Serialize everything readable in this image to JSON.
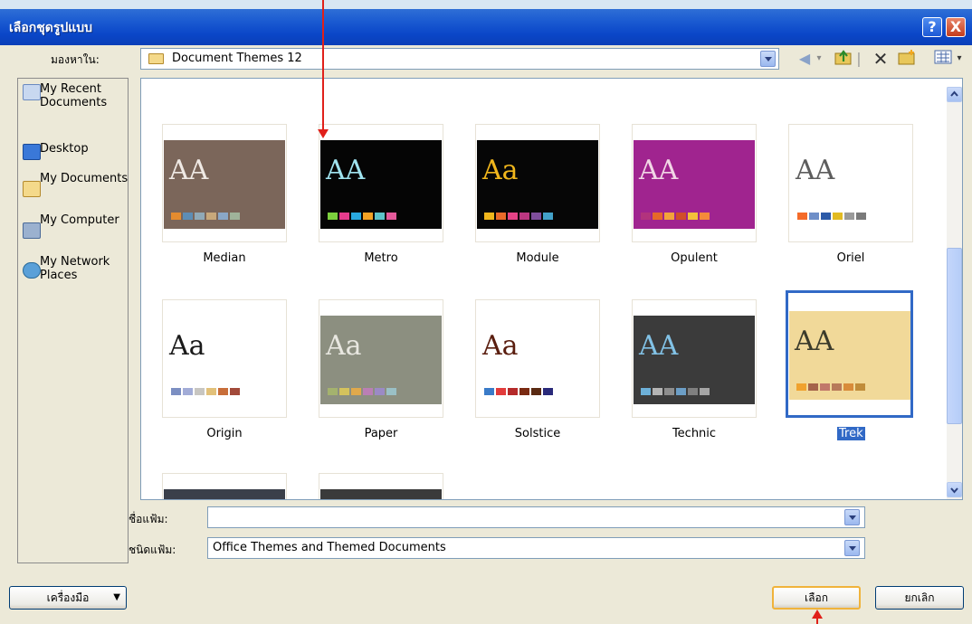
{
  "window": {
    "title": "เลือกชุดรูปแบบ",
    "help_label": "?",
    "close_label": "X"
  },
  "look_in": {
    "label": "มองหาใน:",
    "value": "Document Themes 12"
  },
  "toolbar_icons": [
    "back-icon",
    "up-folder-icon",
    "delete-icon",
    "new-folder-icon",
    "views-icon"
  ],
  "places": [
    {
      "label": "My Recent Documents",
      "icon": "recent-documents-icon"
    },
    {
      "label": "Desktop",
      "icon": "desktop-icon"
    },
    {
      "label": "My Documents",
      "icon": "my-documents-icon"
    },
    {
      "label": "My Computer",
      "icon": "my-computer-icon"
    },
    {
      "label": "My Network Places",
      "icon": "network-places-icon"
    }
  ],
  "themes": [
    {
      "name": "Median",
      "aa": "AA",
      "bg": "#7b665a",
      "aa_color": "#efe9e4",
      "swatches": [
        "#e58c2f",
        "#5d8db5",
        "#90a9b7",
        "#c8a87b",
        "#8aa7c7",
        "#9fb39a"
      ]
    },
    {
      "name": "Metro",
      "aa": "AA",
      "bg": "#050505",
      "aa_color": "#9fe3ef",
      "swatches": [
        "#7ccf3d",
        "#e53c8d",
        "#29a9e0",
        "#f3a325",
        "#5dc3c9",
        "#e55a9b"
      ]
    },
    {
      "name": "Module",
      "aa": "Aa",
      "bg": "#060606",
      "aa_color": "#f0b61c",
      "swatches": [
        "#f0b61c",
        "#ea6a2a",
        "#e64286",
        "#bb3780",
        "#7f4e9c",
        "#42a1c9"
      ]
    },
    {
      "name": "Opulent",
      "aa": "AA",
      "bg": "#a0248f",
      "aa_color": "#f2d6e6",
      "swatches": [
        "#b2337d",
        "#e6682a",
        "#f3a33a",
        "#d14d2a",
        "#f3c13a",
        "#f58b3a"
      ]
    },
    {
      "name": "Oriel",
      "aa": "AA",
      "bg": "#ffffff",
      "aa_color": "#5d5d5d",
      "swatches": [
        "#f46b2a",
        "#6f8fc8",
        "#2c5aa8",
        "#e2bb23",
        "#9a9a9a",
        "#7a7a7a"
      ]
    },
    {
      "name": "Origin",
      "aa": "Aa",
      "bg": "#ffffff",
      "aa_color": "#1a1a1a",
      "swatches": [
        "#7c8fc2",
        "#a2acd7",
        "#c8c6c1",
        "#e2c17a",
        "#c86e3a",
        "#a24a3a"
      ]
    },
    {
      "name": "Paper",
      "aa": "Aa",
      "bg": "#8c8f80",
      "aa_color": "#e8e7e0",
      "swatches": [
        "#a4b26e",
        "#d4c25d",
        "#e0a94c",
        "#ba7fb4",
        "#9b8ac5",
        "#9ac0c6"
      ]
    },
    {
      "name": "Solstice",
      "aa": "Aa",
      "bg": "#ffffff",
      "aa_color": "#5a1e0f",
      "swatches": [
        "#3a7bc8",
        "#e23b3b",
        "#b52a2a",
        "#7a2a12",
        "#5a2a12",
        "#2a2a7a"
      ]
    },
    {
      "name": "Technic",
      "aa": "AA",
      "bg": "#3b3b3b",
      "aa_color": "#82c2e6",
      "swatches": [
        "#6db0d8",
        "#b4b4b4",
        "#8e8e8e",
        "#6c9ec6",
        "#7f7f7f",
        "#a5a5a5"
      ]
    },
    {
      "name": "Trek",
      "aa": "AA",
      "bg": "#f1d999",
      "aa_color": "#3b3b2b",
      "swatches": [
        "#f0a22e",
        "#a5634a",
        "#c1776a",
        "#b87a5a",
        "#d88b3a",
        "#c08c3a"
      ]
    }
  ],
  "partial_themes": [
    {
      "bg": "#3a3f4a"
    },
    {
      "bg": "#3a3a3a"
    }
  ],
  "filename": {
    "label": "ชื่อแฟ้ม:",
    "value": ""
  },
  "filetype": {
    "label": "ชนิดแฟ้ม:",
    "value": "Office Themes and Themed Documents"
  },
  "buttons": {
    "tools": "เครื่องมือ",
    "ok": "เลือก",
    "cancel": "ยกเลิก"
  },
  "selected_theme": "Trek"
}
